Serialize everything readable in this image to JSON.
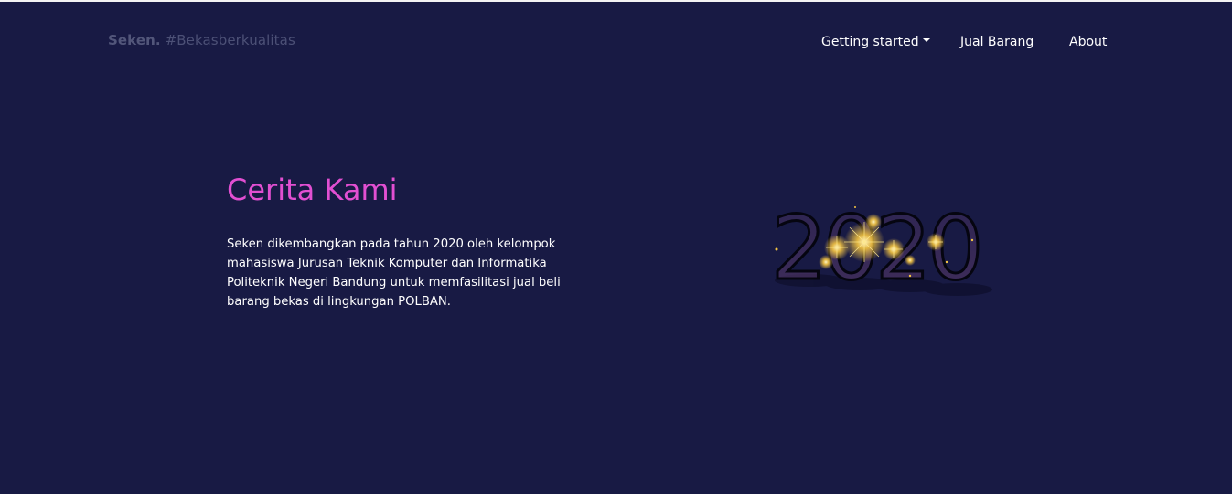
{
  "navbar": {
    "brand_name": "Seken.",
    "brand_tag": "#Bekasberkualitas",
    "links": [
      {
        "label": "Getting started",
        "has_dropdown": true
      },
      {
        "label": "Jual Barang"
      },
      {
        "label": "About"
      }
    ]
  },
  "hero": {
    "title": "Cerita Kami",
    "paragraph": "Seken dikembangkan pada tahun 2020 oleh kelompok mahasiswa Jurusan Teknik Komputer dan Informatika Politeknik Negeri Bandung untuk memfasilitasi jual beli barang bekas di lingkungan POLBAN.",
    "image_text": "2020"
  },
  "colors": {
    "background": "#181a44",
    "accent": "#e24fd2",
    "brand": "#52567a",
    "text": "#ffffff",
    "sparkle": "#f5c542"
  },
  "icons": {
    "dropdown": "caret-down-icon"
  }
}
